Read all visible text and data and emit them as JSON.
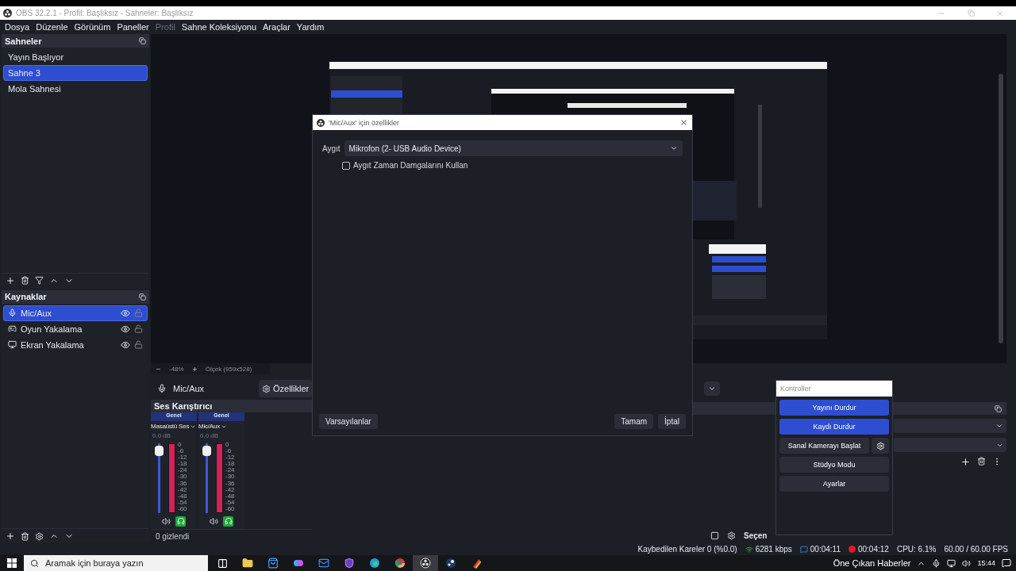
{
  "window": {
    "title": "OBS 32.2.1 - Profil: Başlıksız - Sahneler: Başlıksız"
  },
  "menu": [
    {
      "label": "Dosya",
      "disabled": false
    },
    {
      "label": "Düzenle",
      "disabled": false
    },
    {
      "label": "Görünüm",
      "disabled": false
    },
    {
      "label": "Paneller",
      "disabled": false
    },
    {
      "label": "Profil",
      "disabled": true
    },
    {
      "label": "Sahne Koleksiyonu",
      "disabled": false
    },
    {
      "label": "Araçlar",
      "disabled": false
    },
    {
      "label": "Yardım",
      "disabled": false
    }
  ],
  "scenes": {
    "title": "Sahneler",
    "items": [
      {
        "label": "Yayın Başlıyor",
        "selected": false
      },
      {
        "label": "Sahne 3",
        "selected": true
      },
      {
        "label": "Mola Sahnesi",
        "selected": false
      }
    ]
  },
  "sources": {
    "title": "Kaynaklar",
    "items": [
      {
        "label": "Mic/Aux",
        "kind": "mic",
        "selected": true,
        "visible": true,
        "locked": false
      },
      {
        "label": "Oyun Yakalama",
        "kind": "gamepad",
        "selected": false,
        "visible": true,
        "locked": false
      },
      {
        "label": "Ekran Yakalama",
        "kind": "monitor",
        "selected": false,
        "visible": true,
        "locked": false
      }
    ]
  },
  "preview_bar": {
    "zoom": "-48%",
    "scale": "Ölçek (959x528)"
  },
  "source_toolbar": {
    "source": "Mic/Aux",
    "properties_button": "Özellikler"
  },
  "mixer": {
    "title": "Ses Karıştırıcı",
    "hidden": "0 gizlendi",
    "channels": [
      {
        "group": "Genel",
        "name": "Masaüstü Ses",
        "reading": "0.0 dB",
        "fader": {
          "level": 0.95
        },
        "meter": {
          "level": 1
        },
        "muted": false,
        "monitoring": true,
        "scale": [
          "0",
          "-6",
          "-12",
          "-18",
          "-24",
          "-30",
          "-36",
          "-42",
          "-48",
          "-54",
          "-60"
        ]
      },
      {
        "group": "Genel",
        "name": "Mic/Aux",
        "reading": "0.0 dB",
        "fader": {
          "level": 0.95
        },
        "meter": {
          "level": 1
        },
        "muted": false,
        "monitoring": true,
        "scale": [
          "0",
          "-6",
          "-12",
          "-18",
          "-24",
          "-30",
          "-36",
          "-42",
          "-48",
          "-54",
          "-60"
        ]
      }
    ]
  },
  "transitions": {
    "partial_label": "Seçen"
  },
  "dialog": {
    "title": "'Mic/Aux' için özellikler",
    "device_label": "Aygıt",
    "device_value": "Mikrofon (2- USB Audio Device)",
    "checkbox": {
      "label": "Aygıt Zaman Damgalarını Kullan",
      "checked": false
    },
    "defaults_button": "Varsayılanlar",
    "ok_button": "Tamam",
    "cancel_button": "İptal"
  },
  "controls": {
    "title": "Kontroller",
    "buttons": [
      {
        "label": "Yayını Durdur",
        "active": true,
        "kind": "plain"
      },
      {
        "label": "Kaydı Durdur",
        "active": true,
        "kind": "plain"
      },
      {
        "label": "Sanal Kamerayı Başlat",
        "active": false,
        "kind": "with-settings"
      },
      {
        "label": "Stüdyo Modu",
        "active": false,
        "kind": "plain"
      },
      {
        "label": "Ayarlar",
        "active": false,
        "kind": "plain"
      }
    ]
  },
  "status_bar": {
    "dropped": "Kaybedilen Kareler 0 (%0.0)",
    "bitrate": "6281 kbps",
    "stream_time": "00:04:11",
    "record_time": "00:04:12",
    "cpu": "CPU: 6.1%",
    "fps": "60.00 / 60.00 FPS"
  },
  "taskbar": {
    "search_placeholder": "Aramak için buraya yazın",
    "apps": [
      {
        "kind": "taskview",
        "selected": false
      },
      {
        "kind": "folder",
        "selected": false
      },
      {
        "kind": "store",
        "selected": false
      },
      {
        "kind": "copilot",
        "selected": false
      },
      {
        "kind": "mail",
        "selected": false
      },
      {
        "kind": "shield",
        "selected": false
      },
      {
        "kind": "edge",
        "selected": false
      },
      {
        "kind": "chrome",
        "selected": false
      },
      {
        "kind": "obs",
        "selected": true
      },
      {
        "kind": "steam",
        "selected": false
      },
      {
        "kind": "pen",
        "selected": false
      }
    ],
    "news": "Öne Çıkan Haberler",
    "time": "15:44"
  }
}
